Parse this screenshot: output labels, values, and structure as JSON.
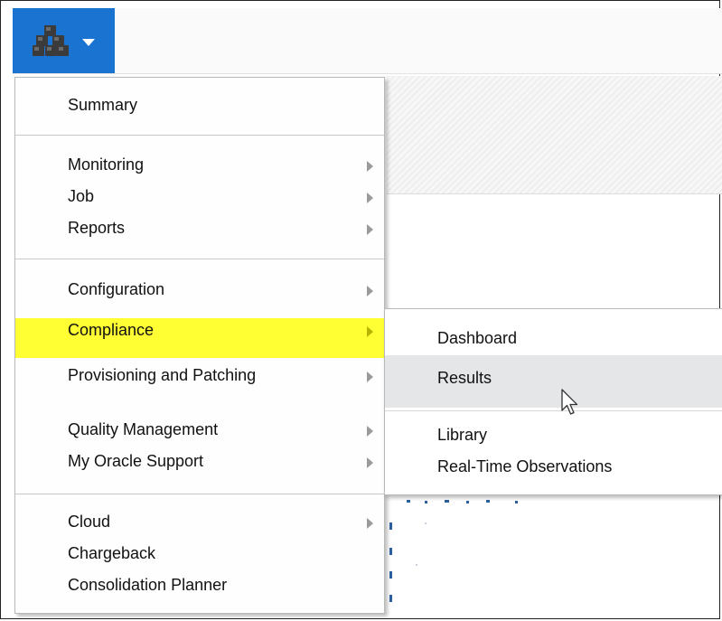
{
  "header": {
    "target_menu_icon": "target-cubes-icon",
    "dropdown_icon": "caret-down-icon"
  },
  "menu": {
    "items": [
      {
        "label": "Summary"
      },
      {
        "label": "Monitoring",
        "has_submenu": true
      },
      {
        "label": "Job",
        "has_submenu": true
      },
      {
        "label": "Reports",
        "has_submenu": true
      },
      {
        "label": "Configuration",
        "has_submenu": true
      },
      {
        "label": "Compliance",
        "has_submenu": true,
        "highlighted": true
      },
      {
        "label": "Provisioning and Patching",
        "has_submenu": true
      },
      {
        "label": "Quality Management",
        "has_submenu": true
      },
      {
        "label": "My Oracle Support",
        "has_submenu": true
      },
      {
        "label": "Cloud",
        "has_submenu": true
      },
      {
        "label": "Chargeback"
      },
      {
        "label": "Consolidation Planner"
      }
    ],
    "highlight_color": "#ffff33"
  },
  "submenu": {
    "items": [
      {
        "label": "Dashboard"
      },
      {
        "label": "Results",
        "hovered": true
      },
      {
        "label": "Library"
      },
      {
        "label": "Real-Time Observations"
      }
    ]
  },
  "colors": {
    "accent": "#1a73d1",
    "hover_bg": "#e5e6e8"
  }
}
